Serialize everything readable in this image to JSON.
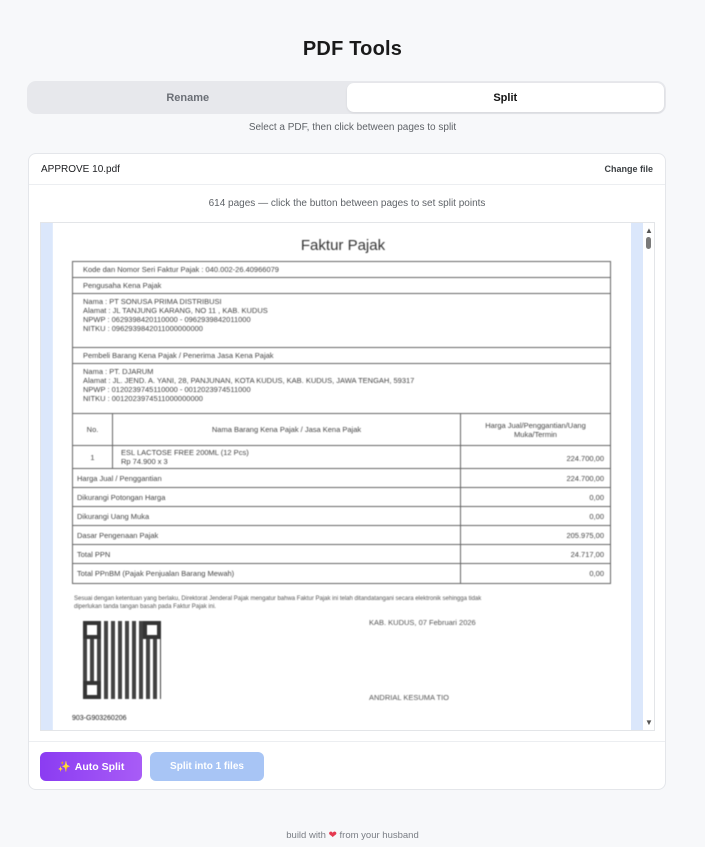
{
  "app": {
    "title": "PDF Tools"
  },
  "tabs": [
    {
      "label": "Rename",
      "active": false
    },
    {
      "label": "Split",
      "active": true
    }
  ],
  "hint": "Select a PDF, then click between pages to split",
  "file": {
    "name": "APPROVE 10.pdf",
    "change_label": "Change file"
  },
  "pages_info": "614 pages — click the button between pages to set split points",
  "document": {
    "title": "Faktur Pajak",
    "serial_label": "Kode dan Nomor Seri Faktur Pajak : 040.002-26.40966079",
    "seller_section": "Pengusaha Kena Pajak",
    "seller_lines": [
      "Nama : PT SONUSA PRIMA DISTRIBUSI",
      "Alamat : JL TANJUNG KARANG, NO 11 , KAB. KUDUS",
      "NPWP : 0629398420110000 - 0962939842011000",
      "NITKU : 0962939842011000000000"
    ],
    "buyer_section": "Pembeli Barang Kena Pajak / Penerima Jasa Kena Pajak",
    "buyer_lines": [
      "Nama : PT. DJARUM",
      "Alamat : JL. JEND. A. YANI, 28, PANJUNAN, KOTA KUDUS, KAB. KUDUS, JAWA TENGAH, 59317",
      "NPWP : 0120239745110000 - 0012023974511000",
      "NITKU : 0012023974511000000000"
    ],
    "table_header": {
      "no": "No.",
      "name": "Nama Barang Kena Pajak / Jasa Kena Pajak",
      "price": "Harga Jual/Penggantian/Uang Muka/Termin"
    },
    "item": {
      "no": "1",
      "name": "ESL LACTOSE FREE 200ML (12 Pcs)",
      "detail": "Rp 74.900 x 3",
      "price": "224.700,00"
    },
    "summary": [
      {
        "label": "Harga Jual / Penggantian",
        "value": "224.700,00"
      },
      {
        "label": "Dikurangi Potongan Harga",
        "value": "0,00"
      },
      {
        "label": "Dikurangi Uang Muka",
        "value": "0,00"
      },
      {
        "label": "Dasar Pengenaan Pajak",
        "value": "205.975,00"
      },
      {
        "label": "Total PPN",
        "value": "24.717,00"
      },
      {
        "label": "Total PPnBM (Pajak Penjualan Barang Mewah)",
        "value": "0,00"
      }
    ],
    "note": "Sesuai dengan ketentuan yang berlaku, Direktorat Jenderal Pajak mengatur bahwa Faktur Pajak ini telah ditandatangani secara elektronik sehingga tidak diperlukan tanda tangan basah pada Faktur Pajak ini.",
    "place_date": "KAB. KUDUS, 07 Februari 2026",
    "signer": "ANDRIAL KESUMA TIO",
    "reference": "903-G903260206"
  },
  "actions": {
    "auto_split": "Auto Split",
    "auto_split_icon": "sparkles-icon",
    "split_into": "Split into 1 files"
  },
  "footer": {
    "prefix": "build with",
    "suffix": "from your husband",
    "heart_color": "#e53950"
  },
  "colors": {
    "accent_purple": "#9747f4",
    "split_button_disabled": "#a8c5f5",
    "page_strip": "#dbe7fb"
  }
}
